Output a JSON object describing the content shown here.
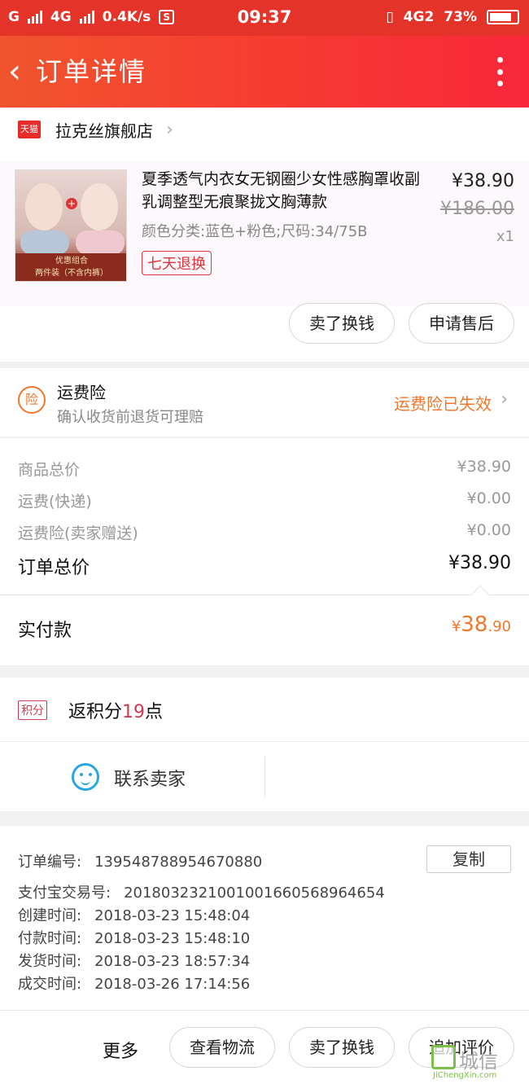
{
  "status_bar": {
    "carrier1": "G",
    "carrier2": "4G",
    "speed": "0.4K/s",
    "s_icon": "S",
    "time": "09:37",
    "network_right": "4G2",
    "battery": "73%"
  },
  "nav": {
    "back_icon": "‹",
    "title": "订单详情"
  },
  "shop": {
    "badge": "天猫",
    "name": "拉克丝旗舰店",
    "arrow": "›"
  },
  "product": {
    "image_banner_line1": "优惠组合",
    "image_banner_line2": "两件装（不含内裤）",
    "title": "夏季透气内衣女无钢圈少女性感胸罩收副乳调整型无痕聚拢文胸薄款",
    "spec": "颜色分类:蓝色+粉色;尺码:34/75B",
    "return_badge": "七天退换",
    "price": "¥38.90",
    "original_price": "¥186.00",
    "quantity": "x1",
    "buttons": {
      "sell": "卖了换钱",
      "after_sale": "申请售后"
    }
  },
  "insurance": {
    "icon_text": "险",
    "title": "运费险",
    "subtitle": "确认收货前退货可理赔",
    "status": "运费险已失效",
    "arrow": "›"
  },
  "fees": {
    "goods_label": "商品总价",
    "goods_value": "¥38.90",
    "shipping_label": "运费(快递)",
    "shipping_value": "¥0.00",
    "insurance_label": "运费险(卖家赠送)",
    "insurance_value": "¥0.00",
    "total_label": "订单总价",
    "total_value": "¥38.90",
    "paid_label": "实付款",
    "paid_symbol": "¥",
    "paid_int": "38",
    "paid_dec": ".90"
  },
  "points": {
    "badge": "积分",
    "prefix": "返积分",
    "amount": "19",
    "suffix": "点"
  },
  "contact": {
    "label": "联系卖家"
  },
  "order_info": {
    "order_no_label": "订单编号:",
    "order_no": "139548788954670880",
    "copy_label": "复制",
    "alipay_label": "支付宝交易号:",
    "alipay_no": "2018032321001001660568964654",
    "created_label": "创建时间:",
    "created": "2018-03-23 15:48:04",
    "paid_label": "付款时间:",
    "paid": "2018-03-23 15:48:10",
    "shipped_label": "发货时间:",
    "shipped": "2018-03-23 18:57:34",
    "closed_label": "成交时间:",
    "closed": "2018-03-26 17:14:56"
  },
  "bottom_bar": {
    "more": "更多",
    "logistics": "查看物流",
    "sell": "卖了换钱",
    "review": "追加评价"
  },
  "watermark": {
    "cn": "城信",
    "en": "JiChengXin.com"
  },
  "colors": {
    "header_red": "#e4342a",
    "accent_orange": "#f0772b",
    "points_red": "#d0394f",
    "contact_blue": "#29a7e1"
  }
}
